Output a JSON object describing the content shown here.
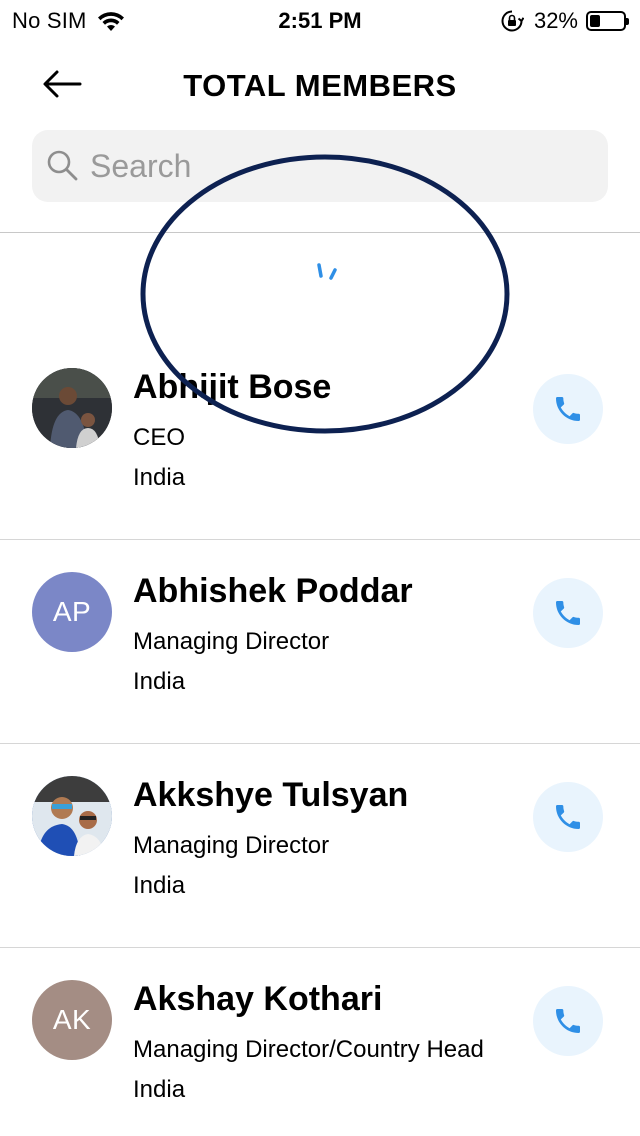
{
  "status_bar": {
    "carrier": "No SIM",
    "time": "2:51 PM",
    "battery_percent": "32%",
    "battery_level": 0.32
  },
  "header": {
    "back_icon": "arrow-left-icon",
    "title": "TOTAL MEMBERS"
  },
  "search": {
    "placeholder": "Search",
    "value": ""
  },
  "members": [
    {
      "name": "Abhijit Bose",
      "role": "CEO",
      "country": "India",
      "initials": "",
      "avatar_color": "#3a3a3a"
    },
    {
      "name": "Abhishek Poddar",
      "role": "Managing Director",
      "country": "India",
      "initials": "AP",
      "avatar_color": "#7b87c7"
    },
    {
      "name": "Akkshye Tulsyan",
      "role": "Managing Director",
      "country": "India",
      "initials": "",
      "avatar_color": "#2f5fa8"
    },
    {
      "name": "Akshay Kothari",
      "role": "Managing Director/Country Head",
      "country": "India",
      "initials": "AK",
      "avatar_color": "#a48d84"
    }
  ],
  "colors": {
    "accent": "#2f8fe6",
    "call_button_bg": "#e9f4fd",
    "annotation": "#0d2151"
  }
}
